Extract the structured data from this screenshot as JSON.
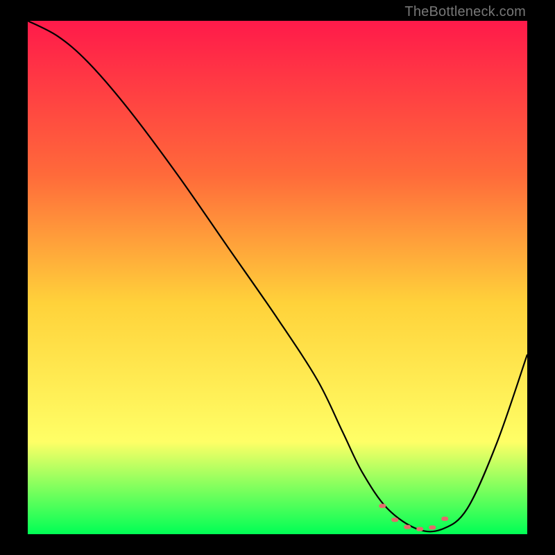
{
  "watermark": "TheBottleneck.com",
  "colors": {
    "background": "#000000",
    "gradient_top": "#ff1a4a",
    "gradient_mid_upper": "#ff6a3a",
    "gradient_mid": "#ffd23a",
    "gradient_lower": "#ffff66",
    "gradient_bottom": "#00ff55",
    "curve": "#000000",
    "marker": "#e36b6b"
  },
  "chart_data": {
    "type": "line",
    "title": "",
    "xlabel": "",
    "ylabel": "",
    "xlim": [
      0,
      100
    ],
    "ylim": [
      0,
      100
    ],
    "series": [
      {
        "name": "bottleneck-curve",
        "x": [
          0,
          6,
          12,
          20,
          30,
          40,
          50,
          58,
          63,
          67,
          72,
          78,
          83,
          88,
          94,
          100
        ],
        "y": [
          100,
          97,
          92,
          83,
          70,
          56,
          42,
          30,
          20,
          12,
          5,
          1,
          1,
          5,
          18,
          35
        ]
      }
    ],
    "markers": {
      "name": "optimal-range",
      "x": [
        71,
        73.5,
        76,
        78.5,
        81,
        83.5
      ],
      "y": [
        5.5,
        2.8,
        1.4,
        1.0,
        1.3,
        3.0
      ]
    }
  }
}
